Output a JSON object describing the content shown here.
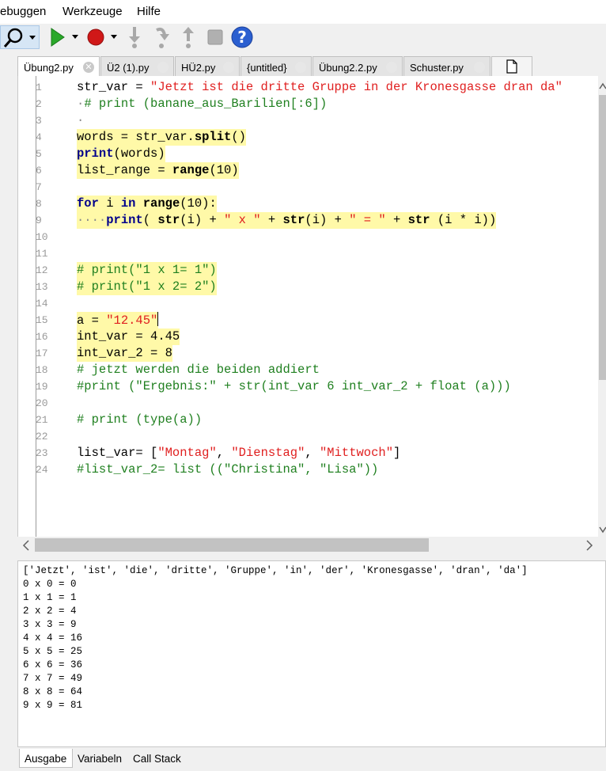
{
  "menu": [
    "ebuggen",
    "Werkzeuge",
    "Hilfe"
  ],
  "tabs": [
    {
      "label": "Übung2.py",
      "active": true
    },
    {
      "label": "Ü2 (1).py",
      "active": false
    },
    {
      "label": "HÜ2.py",
      "active": false
    },
    {
      "label": "{untitled}",
      "active": false
    },
    {
      "label": "Übung2.2.py",
      "active": false
    },
    {
      "label": "Schuster.py",
      "active": false
    }
  ],
  "tab_close_glyph": "✕",
  "line_numbers": [
    "1",
    "2",
    "3",
    "4",
    "5",
    "6",
    "7",
    "8",
    "9",
    "10",
    "11",
    "12",
    "13",
    "14",
    "15",
    "16",
    "17",
    "18",
    "19",
    "20",
    "21",
    "22",
    "23",
    "24"
  ],
  "code": {
    "l1_a": "str_var = ",
    "l1_b": "\"Jetzt ist die dritte Gruppe in der Kronesgasse dran da\"",
    "l2_a": "·",
    "l2_b": "# print (banane_aus_Barilien[:6])",
    "l3_a": "·",
    "l4_a": "words = str_var.",
    "l4_b": "split",
    "l4_c": "()",
    "l5_a": "print",
    "l5_b": "(words)",
    "l6_a": "list_range = ",
    "l6_b": "range",
    "l6_c": "(10)",
    "l8_a": "for",
    "l8_b": " i ",
    "l8_c": "in",
    "l8_d": " ",
    "l8_e": "range",
    "l8_f": "(10):",
    "l9_a": "····",
    "l9_b": "print",
    "l9_c": "( ",
    "l9_d": "str",
    "l9_e": "(i) + ",
    "l9_f": "\" x \"",
    "l9_g": " + ",
    "l9_h": "str",
    "l9_i": "(i) + ",
    "l9_j": "\" = \"",
    "l9_k": " + ",
    "l9_l": "str",
    "l9_m": " (i * i))",
    "l12": "# print(\"1 x 1= 1\")",
    "l13": "# print(\"1 x 2= 2\")",
    "l15_a": "a = ",
    "l15_b": "\"12.45\"",
    "l16": "int_var = 4.45",
    "l17": "int_var_2 = 8",
    "l18": "# jetzt werden die beiden addiert",
    "l19": "#print (\"Ergebnis:\" + str(int_var 6 int_var_2 + float (a)))",
    "l21": "# print (type(a))",
    "l23_a": "list_var= [",
    "l23_b": "\"Montag\"",
    "l23_c": ", ",
    "l23_d": "\"Dienstag\"",
    "l23_e": ", ",
    "l23_f": "\"Mittwoch\"",
    "l23_g": "]",
    "l24": "#list_var_2= list ((\"Christina\", \"Lisa\"))"
  },
  "console_output": [
    "['Jetzt', 'ist', 'die', 'dritte', 'Gruppe', 'in', 'der', 'Kronesgasse', 'dran', 'da']",
    "0 x 0 = 0",
    "1 x 1 = 1",
    "2 x 2 = 4",
    "3 x 3 = 9",
    "4 x 4 = 16",
    "5 x 5 = 25",
    "6 x 6 = 36",
    "7 x 7 = 49",
    "8 x 8 = 64",
    "9 x 9 = 81"
  ],
  "bottom_tabs": [
    {
      "label": "Ausgabe",
      "active": true
    },
    {
      "label": "Variabeln",
      "active": false
    },
    {
      "label": "Call Stack",
      "active": false
    }
  ],
  "icons": {
    "search": "search-icon",
    "run": "run-icon",
    "debug": "debug-icon",
    "step_into": "step-into-icon",
    "step_over": "step-over-icon",
    "step_out": "step-out-icon",
    "stop": "stop-icon",
    "help": "help-icon",
    "new_file": "new-file-icon"
  },
  "colors": {
    "keyword": "#00008b",
    "string": "#e02020",
    "comment": "#208020",
    "highlight": "#fff9a8",
    "run_green": "#2aa82a",
    "debug_red": "#d01818",
    "help_blue": "#2b5fd0"
  }
}
